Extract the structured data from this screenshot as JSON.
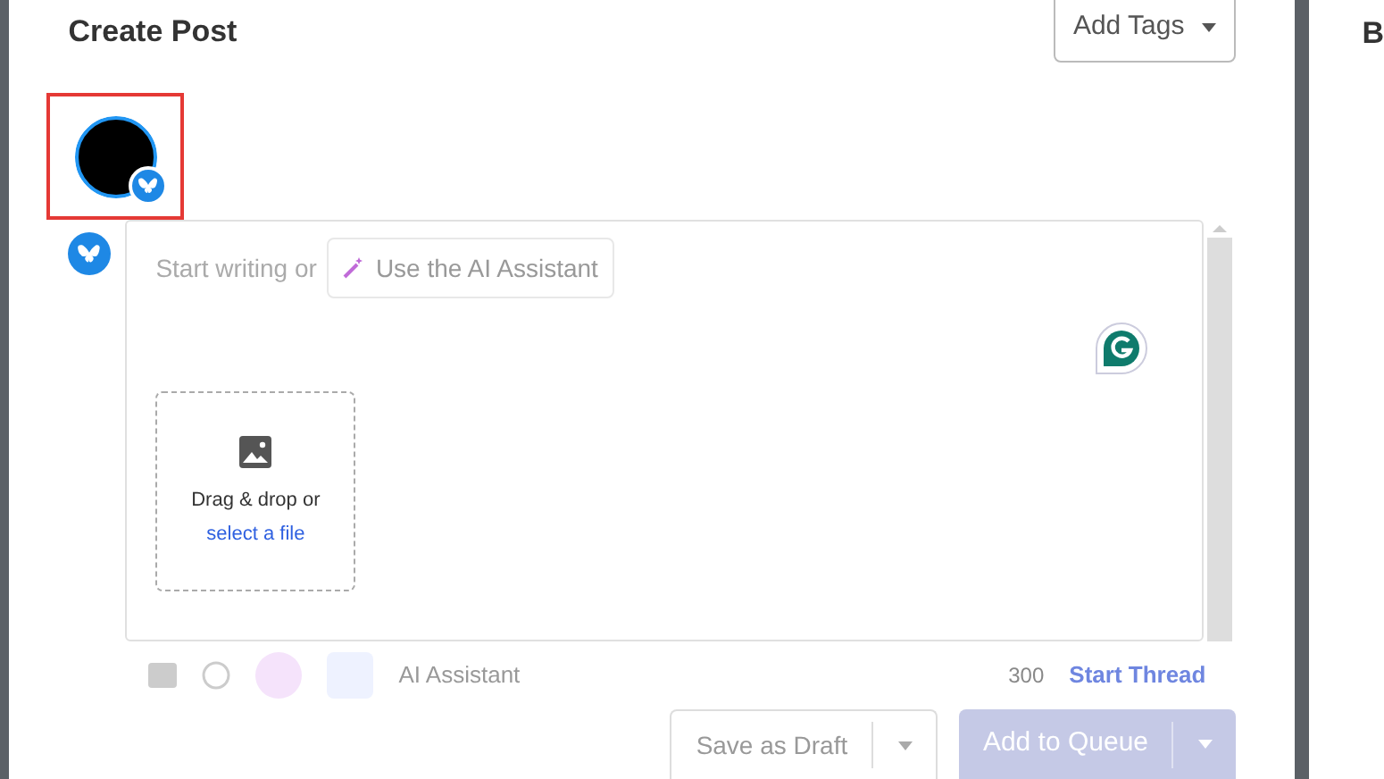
{
  "modal": {
    "title": "Create Post",
    "add_tags": "Add Tags"
  },
  "profile": {
    "selected": true
  },
  "editor": {
    "prompt": "Start writing or",
    "ai_button": "Use the AI Assistant",
    "media_text": "Drag & drop or",
    "media_link": "select a file"
  },
  "toolbar": {
    "ai_assistant": "AI Assistant",
    "char_count": "300",
    "start_thread": "Start Thread"
  },
  "footer": {
    "save_draft": "Save as Draft",
    "add_to_queue": "Add to Queue"
  },
  "background": {
    "letter": "B"
  }
}
